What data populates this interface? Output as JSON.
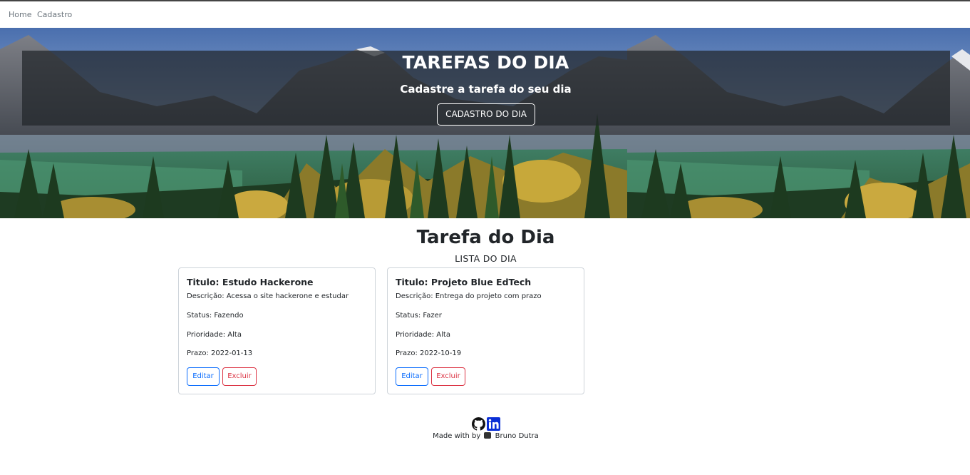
{
  "nav": {
    "items": [
      "Home",
      "Cadastro"
    ]
  },
  "hero": {
    "title": "TAREFAS DO DIA",
    "subtitle": "Cadastre a tarefa do seu dia",
    "button_label": "CADASTRO DO DIA"
  },
  "main": {
    "title": "Tarefa do Dia",
    "subtitle": "LISTA DO DIA",
    "cards": [
      {
        "title": "Titulo: Estudo Hackerone",
        "description": "Descrição: Acessa o site hackerone e estudar",
        "status": "Status: Fazendo",
        "priority": "Prioridade: Alta",
        "deadline": "Prazo: 2022-01-13",
        "edit_label": "Editar",
        "delete_label": "Excluir"
      },
      {
        "title": "Titulo: Projeto Blue EdTech",
        "description": "Descrição: Entrega do projeto com prazo",
        "status": "Status: Fazer",
        "priority": "Prioridade: Alta",
        "deadline": "Prazo: 2022-10-19",
        "edit_label": "Editar",
        "delete_label": "Excluir"
      }
    ]
  },
  "footer": {
    "made_with": "Made with by",
    "author": "Bruno Dutra",
    "icons": [
      "github-icon",
      "linkedin-icon",
      "heart-icon"
    ]
  },
  "colors": {
    "primary": "#0d6efd",
    "danger": "#dc3545",
    "linkedin": "#0a2fd6",
    "hero_overlay": "#212529"
  }
}
